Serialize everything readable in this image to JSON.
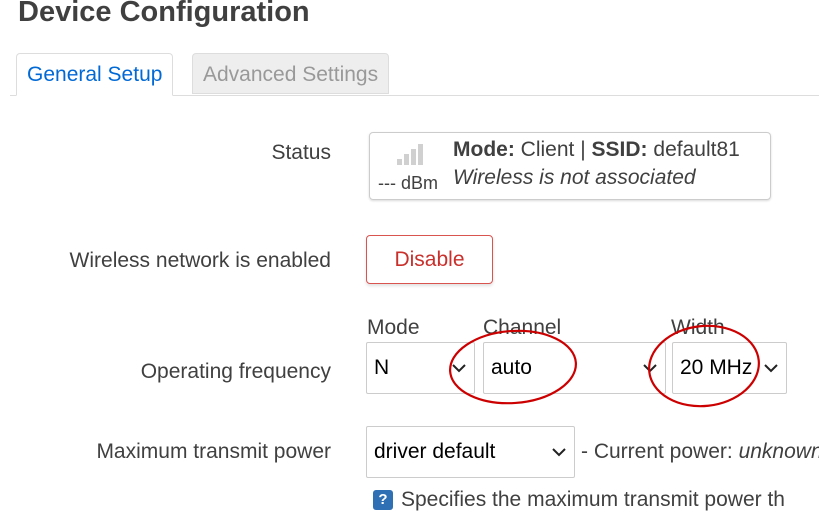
{
  "page": {
    "title": "Device Configuration"
  },
  "tabs": [
    {
      "label": "General Setup",
      "active": true
    },
    {
      "label": "Advanced Settings",
      "active": false
    }
  ],
  "status": {
    "label": "Status",
    "signal_icon": "signal-strength-icon",
    "dbm": "--- dBm",
    "mode_label": "Mode:",
    "mode_value": "Client",
    "separator": "|",
    "ssid_label": "SSID:",
    "ssid_value": "default81",
    "association": "Wireless is not associated"
  },
  "wireless": {
    "label": "Wireless network is enabled",
    "button_label": "Disable"
  },
  "frequency": {
    "label": "Operating frequency",
    "mode": {
      "header": "Mode",
      "value": "N"
    },
    "channel": {
      "header": "Channel",
      "value": "auto"
    },
    "width": {
      "header": "Width",
      "value": "20 MHz"
    }
  },
  "txpower": {
    "label": "Maximum transmit power",
    "value": "driver default",
    "current_prefix": "- Current power:",
    "current_value": "unknown",
    "help_icon": "help-icon",
    "help_text": "Specifies the maximum transmit power th"
  },
  "colors": {
    "accent": "#0069d6",
    "danger": "#d9534f",
    "annotation": "#cc0000"
  }
}
